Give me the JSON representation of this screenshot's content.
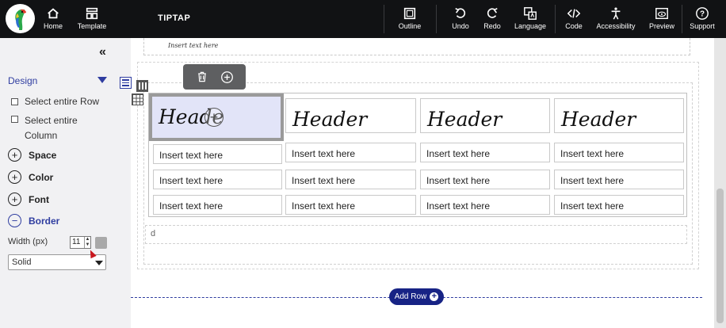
{
  "topbar": {
    "home": "Home",
    "template": "Template",
    "title": "TIPTAP",
    "outline": "Outline",
    "undo": "Undo",
    "redo": "Redo",
    "language": "Language",
    "code": "Code",
    "accessibility": "Accessibility",
    "preview": "Preview",
    "support": "Support"
  },
  "sidebar": {
    "collapse_glyph": "«",
    "design": "Design",
    "select_row": "Select entire Row",
    "select_col_1": "Select entire",
    "select_col_2": "Column",
    "sections": [
      {
        "label": "Space",
        "symbol": "+"
      },
      {
        "label": "Color",
        "symbol": "+"
      },
      {
        "label": "Font",
        "symbol": "+"
      },
      {
        "label": "Border",
        "symbol": "−"
      }
    ],
    "width_label": "Width (px)",
    "width_value": "11",
    "border_style": "Solid",
    "border_color": "#a9a9a9"
  },
  "canvas": {
    "prev_text": "Insert text here",
    "table": {
      "headers": [
        "Heade",
        "Header",
        "Header",
        "Header"
      ],
      "rows": [
        [
          "Insert text here",
          "Insert text here",
          "Insert text here",
          "Insert text here"
        ],
        [
          "Insert text here",
          "Insert text here",
          "Insert text here",
          "Insert text here"
        ],
        [
          "Insert text here",
          "Insert text here",
          "Insert text here",
          "Insert text here"
        ]
      ]
    },
    "d_text": "d",
    "add_row": "Add Row"
  },
  "colors": {
    "topbar": "#111214",
    "accent": "#2f3da0",
    "add_row_bg": "#172385",
    "selected_cell_bg": "#e2e4f8"
  }
}
